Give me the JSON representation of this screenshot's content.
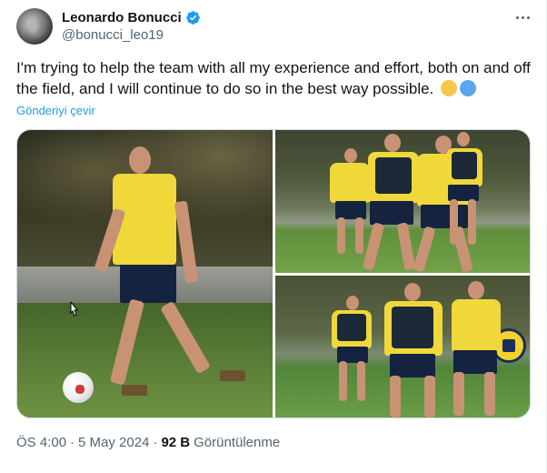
{
  "author": {
    "display_name": "Leonardo Bonucci",
    "handle": "@bonucci_leo19",
    "verified": true,
    "verified_color": "#1d9bf0"
  },
  "tweet": {
    "text": "I'm trying to help the team with all my experience and effort, both on and off the field, and I will continue to do so in the best way possible.",
    "emojis": [
      "yellow-circle",
      "blue-circle"
    ],
    "translate_label": "Gönderiyi çevir"
  },
  "media": {
    "photo_count": 3,
    "photos": [
      "player-dribbling-photo",
      "training-duel-photo",
      "training-drill-photo"
    ]
  },
  "meta": {
    "time": "ÖS 4:00",
    "separator": "·",
    "date": "5 May 2024",
    "views_count": "92 B",
    "views_label": "Görüntülenme"
  },
  "colors": {
    "text_primary": "#0f1419",
    "text_secondary": "#536471",
    "link": "#1d9bf0",
    "border": "#cfd9de"
  }
}
